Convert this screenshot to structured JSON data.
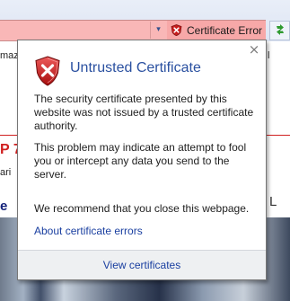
{
  "browser": {
    "address_dropdown_glyph": "▾",
    "cert_badge_label": "Certificate Error",
    "error_color": "#f7a8a8"
  },
  "background_page": {
    "fragment_1": "maz",
    "fragment_2": "P 7",
    "fragment_3": "ari",
    "fragment_4": "e",
    "fragment_5": "l",
    "fragment_6": "L"
  },
  "popup": {
    "close_glyph": "×",
    "title": "Untrusted Certificate",
    "paragraphs": [
      "The security certificate presented by this website was not issued by a trusted certificate authority.",
      "This problem may indicate an attempt to fool you or intercept any data you send to the server.",
      "We recommend that you close this webpage."
    ],
    "link_label": "About certificate errors",
    "footer_link_label": "View certificates",
    "title_color": "#2a50a0",
    "link_color": "#1a3fa0"
  }
}
